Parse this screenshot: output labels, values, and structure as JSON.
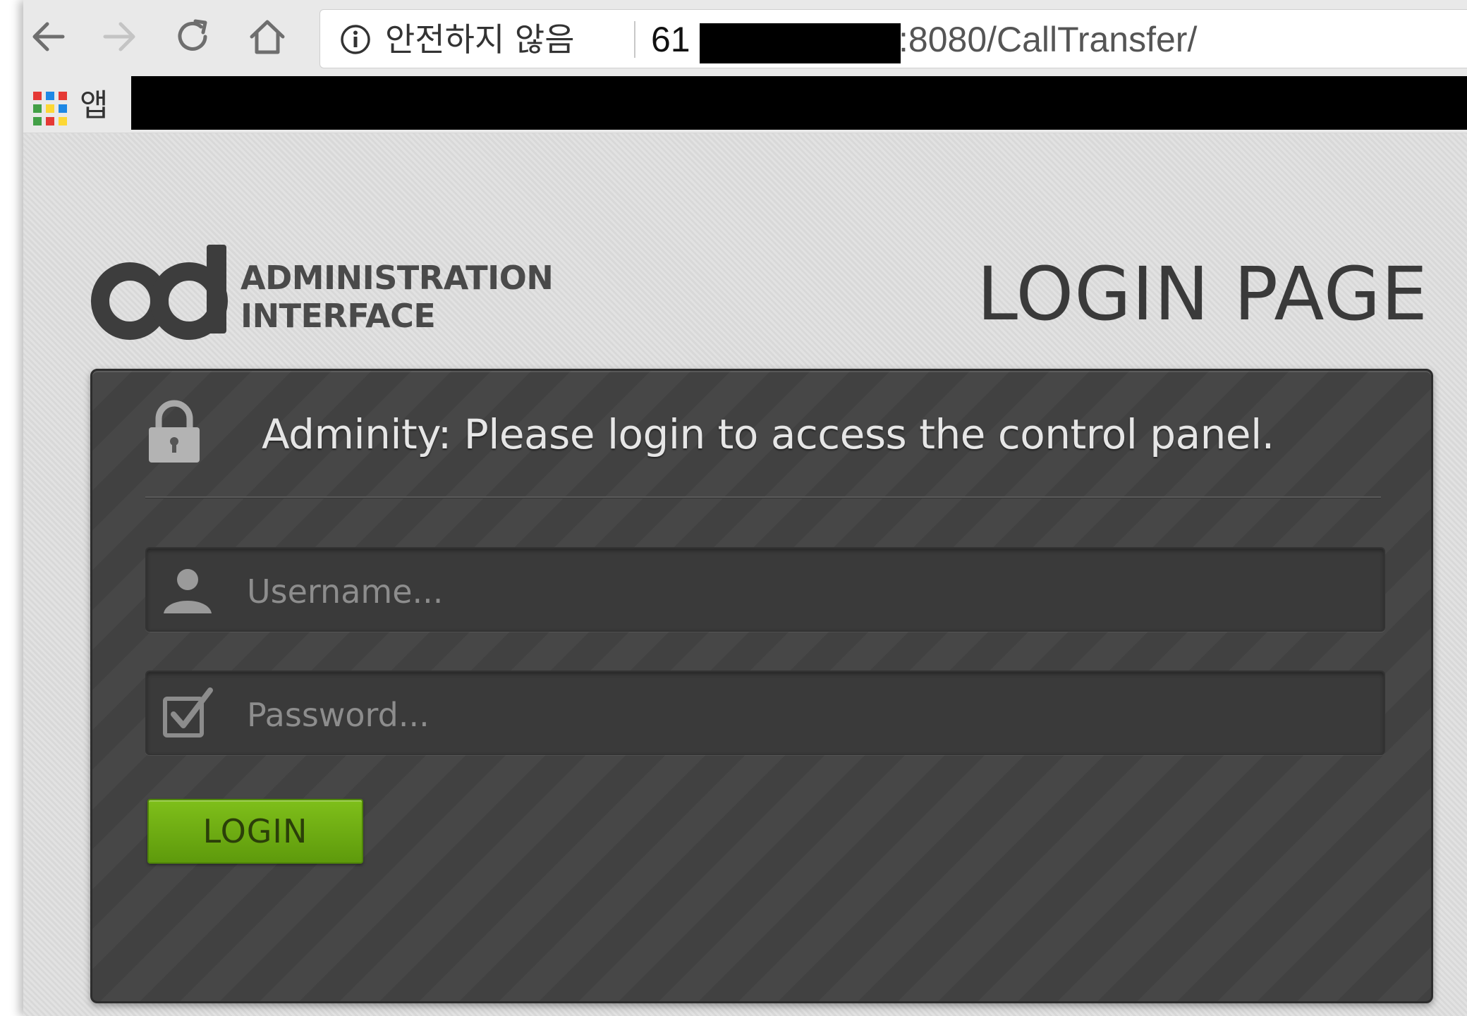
{
  "browser": {
    "nav": {
      "back_icon": "arrow-left-icon",
      "forward_icon": "arrow-right-icon",
      "reload_icon": "reload-icon",
      "home_icon": "home-icon"
    },
    "omnibox": {
      "security_icon": "info-icon",
      "security_label": "안전하지 않음",
      "url_host_visible": "61",
      "url_rest": ":8080/CallTransfer/"
    },
    "bookmarks": {
      "apps_icon": "apps-grid-icon",
      "apps_label": "앱"
    }
  },
  "page": {
    "logo": {
      "line1": "ADMINISTRATION",
      "line2": "INTERFACE"
    },
    "title": "LOGIN PAGE",
    "panel": {
      "heading": "Adminity: Please login to access the control panel.",
      "username_placeholder": "Username...",
      "password_placeholder": "Password...",
      "login_label": "LOGIN"
    },
    "colors": {
      "background": "#dcdcdc",
      "panel": "#434343",
      "button": "#6ead14",
      "title_text": "#3a3a3a"
    }
  }
}
